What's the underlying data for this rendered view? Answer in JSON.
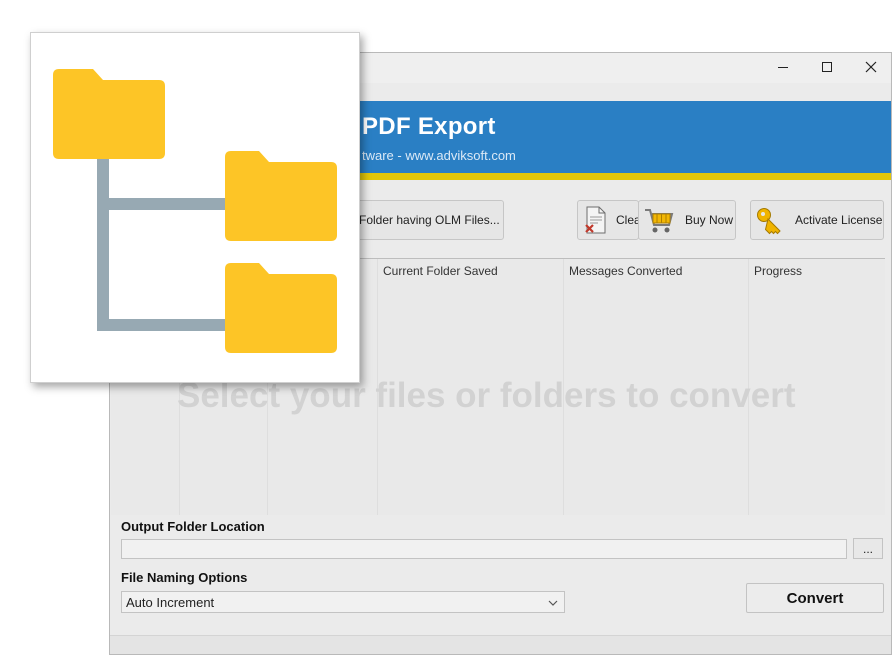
{
  "window": {
    "controls": {
      "minimize_icon": "minimize-icon",
      "maximize_icon": "maximize-icon",
      "close_icon": "close-icon"
    }
  },
  "banner": {
    "title": "PDF Export",
    "subtitle": "tware - www.adviksoft.com",
    "bg_color": "#2a7fc4",
    "stripe_color": "#e2c60a"
  },
  "toolbar": {
    "select_folder_label": "Folder having OLM Files...",
    "clear_label": "Clea",
    "buy_now_label": "Buy Now",
    "activate_label": "Activate License"
  },
  "table": {
    "columns": [
      "Current Folder Saved",
      "Messages Converted",
      "Progress"
    ],
    "placeholder": "Select your files or folders to convert"
  },
  "output": {
    "label": "Output Folder Location",
    "path_value": "",
    "browse_label": "..."
  },
  "naming": {
    "label": "File Naming Options",
    "selected": "Auto Increment"
  },
  "convert": {
    "label": "Convert"
  },
  "overlay": {
    "icon": "folder-tree-icon",
    "folder_color": "#fdc526",
    "line_color": "#97a9b3"
  }
}
